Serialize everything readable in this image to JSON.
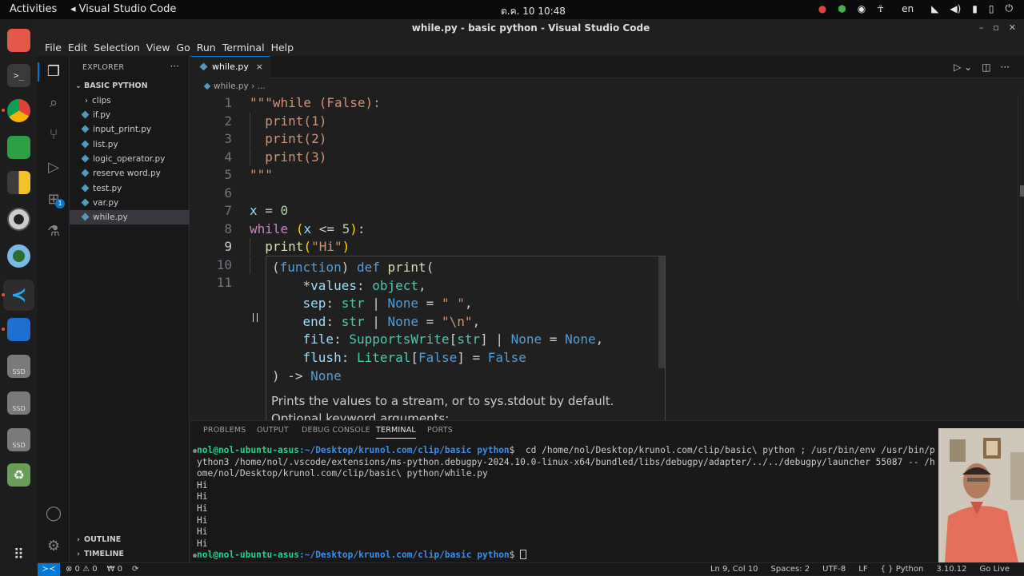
{
  "system_bar": {
    "activities": "Activities",
    "app_name": "Visual Studio Code",
    "clock": "ต.ค. 10 10:48",
    "language": "en"
  },
  "window": {
    "title": "while.py - basic python - Visual Studio Code"
  },
  "menu": [
    "File",
    "Edit",
    "Selection",
    "View",
    "Go",
    "Run",
    "Terminal",
    "Help"
  ],
  "explorer": {
    "header": "EXPLORER",
    "more": "···",
    "folder": "BASIC PYTHON",
    "items": [
      {
        "label": "clips",
        "type": "folder"
      },
      {
        "label": "if.py",
        "type": "file"
      },
      {
        "label": "input_print.py",
        "type": "file"
      },
      {
        "label": "list.py",
        "type": "file"
      },
      {
        "label": "logic_operator.py",
        "type": "file"
      },
      {
        "label": "reserve word.py",
        "type": "file"
      },
      {
        "label": "test.py",
        "type": "file"
      },
      {
        "label": "var.py",
        "type": "file"
      },
      {
        "label": "while.py",
        "type": "file",
        "selected": true
      }
    ],
    "outline": "OUTLINE",
    "timeline": "TIMELINE"
  },
  "activity_badge": "1",
  "tab": {
    "label": "while.py",
    "close": "×"
  },
  "breadcrumb": {
    "file": "while.py",
    "sep": "›",
    "rest": "..."
  },
  "editor": {
    "line_numbers": [
      "1",
      "2",
      "3",
      "4",
      "5",
      "6",
      "7",
      "8",
      "9",
      "10",
      "11"
    ],
    "current_line": "9",
    "code_lines": [
      "\"\"\"while (False):",
      "  print(1)",
      "  print(2)",
      "  print(3)",
      "\"\"\"",
      "",
      "x = 0",
      "while (x <= 5):",
      "  print(\"Hi\")",
      "",
      ""
    ]
  },
  "hover": {
    "doc_line1": "Prints the values to a stream, or to sys.stdout by default.",
    "doc_line2": "Optional keyword arguments:"
  },
  "panel": {
    "tabs": [
      "PROBLEMS",
      "OUTPUT",
      "DEBUG CONSOLE",
      "TERMINAL",
      "PORTS"
    ],
    "active_tab": "TERMINAL",
    "terminal": {
      "prompt_user": "nol@nol-ubuntu-asus",
      "prompt_path": ":~/Desktop/krunol.com/clip/basic python",
      "prompt_end": "$ ",
      "command_line1": " cd /home/nol/Desktop/krunol.com/clip/basic\\ python ; /usr/bin/env /usr/bin/p",
      "command_line2": "ython3 /home/nol/.vscode/extensions/ms-python.debugpy-2024.10.0-linux-x64/bundled/libs/debugpy/adapter/../../debugpy/launcher 55087 -- /h",
      "command_line3": "ome/nol/Desktop/krunol.com/clip/basic\\ python/while.py",
      "output": [
        "Hi",
        "Hi",
        "Hi",
        "Hi",
        "Hi",
        "Hi"
      ]
    }
  },
  "status": {
    "errors": "⊗ 0 ⚠ 0",
    "ports": "₩ 0",
    "position": "Ln 9, Col 10",
    "spaces": "Spaces: 2",
    "encoding": "UTF-8",
    "eol": "LF",
    "language": "{ } Python",
    "version": "3.10.12",
    "golive": "Go Live"
  },
  "colors": {
    "accent": "#0078d4",
    "editor_bg": "#1f1f1f",
    "string": "#ce9178",
    "keyword": "#c586c0"
  }
}
